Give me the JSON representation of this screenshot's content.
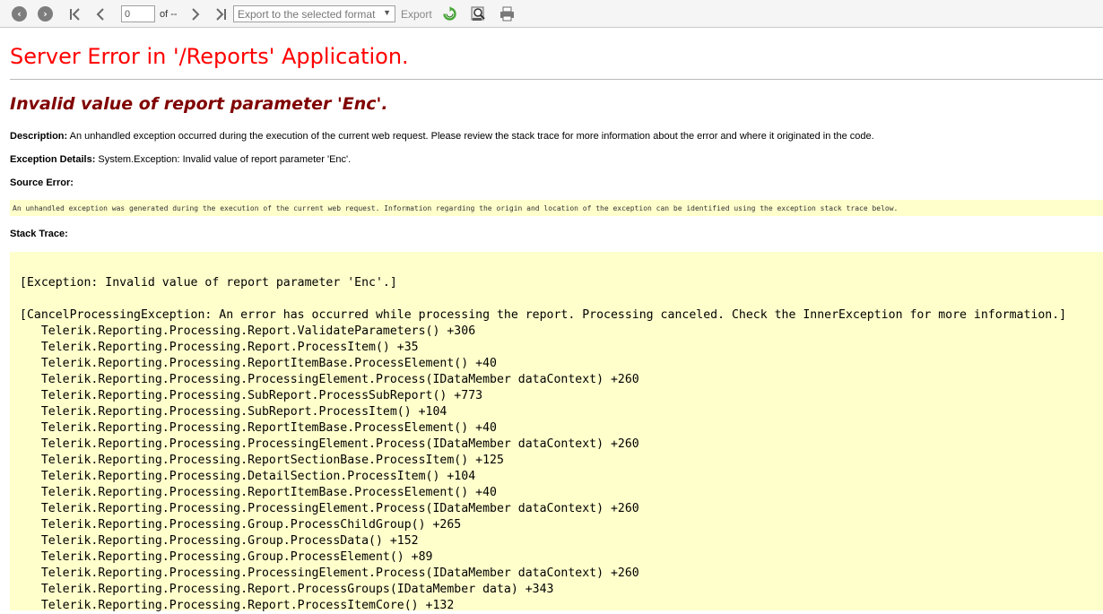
{
  "toolbar": {
    "page_value": "0",
    "of_label": "of --",
    "export_format_placeholder": "Export to the selected format",
    "export_label": "Export",
    "colors": {
      "refresh": "#4aa83a",
      "icons": "#7d7d7d"
    }
  },
  "error": {
    "title": "Server Error in '/Reports' Application.",
    "subtitle": "Invalid value of report parameter 'Enc'.",
    "description_label": "Description:",
    "description_text": "An unhandled exception occurred during the execution of the current web request. Please review the stack trace for more information about the error and where it originated in the code.",
    "exception_label": "Exception Details:",
    "exception_text": "System.Exception: Invalid value of report parameter 'Enc'.",
    "source_label": "Source Error:",
    "source_text": "An unhandled exception was generated during the execution of the current web request. Information regarding the origin and location of the exception can be identified using the exception stack trace below.",
    "stack_label": "Stack Trace:"
  },
  "stack_trace": [
    "[Exception: Invalid value of report parameter 'Enc'.]",
    "",
    "[CancelProcessingException: An error has occurred while processing the report. Processing canceled. Check the InnerException for more information.]",
    "   Telerik.Reporting.Processing.Report.ValidateParameters() +306",
    "   Telerik.Reporting.Processing.Report.ProcessItem() +35",
    "   Telerik.Reporting.Processing.ReportItemBase.ProcessElement() +40",
    "   Telerik.Reporting.Processing.ProcessingElement.Process(IDataMember dataContext) +260",
    "   Telerik.Reporting.Processing.SubReport.ProcessSubReport() +773",
    "   Telerik.Reporting.Processing.SubReport.ProcessItem() +104",
    "   Telerik.Reporting.Processing.ReportItemBase.ProcessElement() +40",
    "   Telerik.Reporting.Processing.ProcessingElement.Process(IDataMember dataContext) +260",
    "   Telerik.Reporting.Processing.ReportSectionBase.ProcessItem() +125",
    "   Telerik.Reporting.Processing.DetailSection.ProcessItem() +104",
    "   Telerik.Reporting.Processing.ReportItemBase.ProcessElement() +40",
    "   Telerik.Reporting.Processing.ProcessingElement.Process(IDataMember dataContext) +260",
    "   Telerik.Reporting.Processing.Group.ProcessChildGroup() +265",
    "   Telerik.Reporting.Processing.Group.ProcessData() +152",
    "   Telerik.Reporting.Processing.Group.ProcessElement() +89",
    "   Telerik.Reporting.Processing.ProcessingElement.Process(IDataMember dataContext) +260",
    "   Telerik.Reporting.Processing.Report.ProcessGroups(IDataMember data) +343",
    "   Telerik.Reporting.Processing.Report.ProcessItemCore() +132"
  ]
}
